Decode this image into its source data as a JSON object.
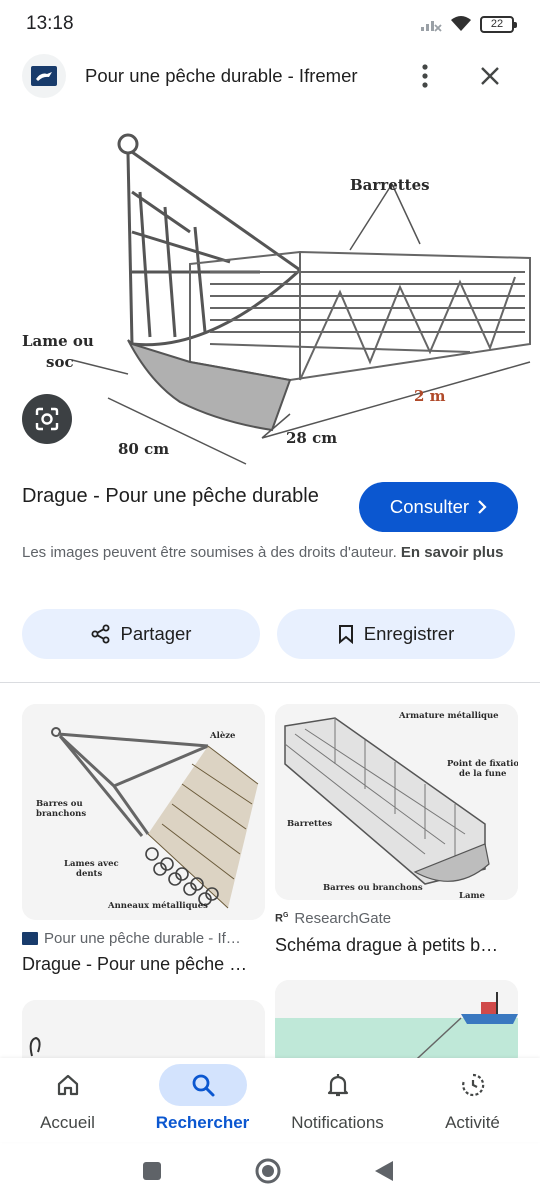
{
  "status": {
    "time": "13:18",
    "battery": "22"
  },
  "header": {
    "title": "Pour une pêche durable - Ifremer",
    "favicon": "ifremer-logo"
  },
  "main_image": {
    "labels": {
      "barrettes": "Barrettes",
      "lame_ou": "Lame ou",
      "soc": "soc",
      "two_m": "2 m",
      "twentyeight_cm": "28 cm",
      "eighty_cm": "80 cm"
    }
  },
  "result": {
    "title": "Drague - Pour une pêche durable",
    "consult_label": "Consulter",
    "copyright_text": "Les images peuvent être soumises à des droits d'auteur.",
    "learn_more": "En savoir plus"
  },
  "actions": {
    "share_label": "Partager",
    "save_label": "Enregistrer"
  },
  "related": [
    {
      "source": "Pour une pêche durable - If…",
      "caption": "Drague - Pour une pêche …",
      "labels": {
        "alese": "Alèze",
        "barres": "Barres ou",
        "branchons": "branchons",
        "lames": "Lames avec",
        "dents": "dents",
        "anneaux": "Anneaux métalliques"
      }
    },
    {
      "source": "ResearchGate",
      "caption": "Schéma drague à petits b…",
      "labels": {
        "armature": "Armature métallique",
        "point": "Point de fixation",
        "fune": "de la fune",
        "barrettes": "Barrettes",
        "barres": "Barres ou branchons",
        "lame": "Lame"
      }
    }
  ],
  "bottom_nav": [
    {
      "label": "Accueil",
      "icon": "home-icon"
    },
    {
      "label": "Rechercher",
      "icon": "search-icon",
      "active": true
    },
    {
      "label": "Notifications",
      "icon": "bell-icon"
    },
    {
      "label": "Activité",
      "icon": "history-icon"
    }
  ],
  "colors": {
    "accent": "#0b57d0",
    "chip_bg": "#e8f0fe",
    "active_pill": "#d3e3fd"
  }
}
